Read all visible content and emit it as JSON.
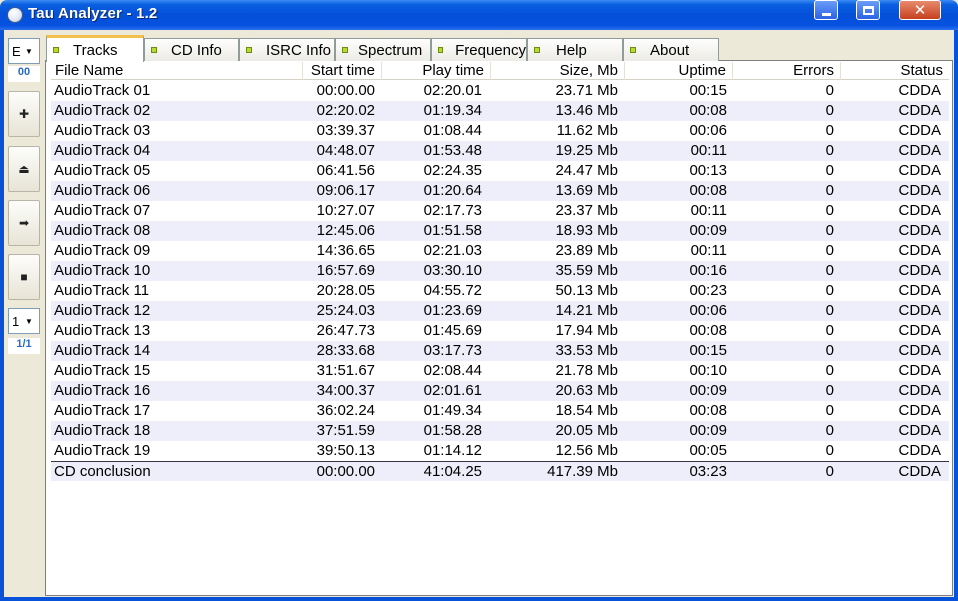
{
  "window": {
    "title": "Tau Analyzer - 1.2"
  },
  "sidebar": {
    "combo_top_value": "E",
    "track_value": "00",
    "combo_bottom_value": "1",
    "index_value": "1/1",
    "buttons": [
      {
        "name": "add-button",
        "glyph": "✚"
      },
      {
        "name": "eject-button",
        "glyph": "⏏"
      },
      {
        "name": "next-button",
        "glyph": "➡"
      },
      {
        "name": "stop-button",
        "glyph": "■"
      }
    ]
  },
  "tabs": [
    "Tracks",
    "CD Info",
    "ISRC Info",
    "Spectrum",
    "Frequency",
    "Help",
    "About"
  ],
  "table": {
    "columns": [
      "File Name",
      "Start time",
      "Play time",
      "Size, Mb",
      "Uptime",
      "Errors",
      "Status"
    ],
    "rows": [
      [
        "AudioTrack 01",
        "00:00.00",
        "02:20.01",
        "23.71 Mb",
        "00:15",
        "0",
        "CDDA"
      ],
      [
        "AudioTrack 02",
        "02:20.02",
        "01:19.34",
        "13.46 Mb",
        "00:08",
        "0",
        "CDDA"
      ],
      [
        "AudioTrack 03",
        "03:39.37",
        "01:08.44",
        "11.62 Mb",
        "00:06",
        "0",
        "CDDA"
      ],
      [
        "AudioTrack 04",
        "04:48.07",
        "01:53.48",
        "19.25 Mb",
        "00:11",
        "0",
        "CDDA"
      ],
      [
        "AudioTrack 05",
        "06:41.56",
        "02:24.35",
        "24.47 Mb",
        "00:13",
        "0",
        "CDDA"
      ],
      [
        "AudioTrack 06",
        "09:06.17",
        "01:20.64",
        "13.69 Mb",
        "00:08",
        "0",
        "CDDA"
      ],
      [
        "AudioTrack 07",
        "10:27.07",
        "02:17.73",
        "23.37 Mb",
        "00:11",
        "0",
        "CDDA"
      ],
      [
        "AudioTrack 08",
        "12:45.06",
        "01:51.58",
        "18.93 Mb",
        "00:09",
        "0",
        "CDDA"
      ],
      [
        "AudioTrack 09",
        "14:36.65",
        "02:21.03",
        "23.89 Mb",
        "00:11",
        "0",
        "CDDA"
      ],
      [
        "AudioTrack 10",
        "16:57.69",
        "03:30.10",
        "35.59 Mb",
        "00:16",
        "0",
        "CDDA"
      ],
      [
        "AudioTrack 11",
        "20:28.05",
        "04:55.72",
        "50.13 Mb",
        "00:23",
        "0",
        "CDDA"
      ],
      [
        "AudioTrack 12",
        "25:24.03",
        "01:23.69",
        "14.21 Mb",
        "00:06",
        "0",
        "CDDA"
      ],
      [
        "AudioTrack 13",
        "26:47.73",
        "01:45.69",
        "17.94 Mb",
        "00:08",
        "0",
        "CDDA"
      ],
      [
        "AudioTrack 14",
        "28:33.68",
        "03:17.73",
        "33.53 Mb",
        "00:15",
        "0",
        "CDDA"
      ],
      [
        "AudioTrack 15",
        "31:51.67",
        "02:08.44",
        "21.78 Mb",
        "00:10",
        "0",
        "CDDA"
      ],
      [
        "AudioTrack 16",
        "34:00.37",
        "02:01.61",
        "20.63 Mb",
        "00:09",
        "0",
        "CDDA"
      ],
      [
        "AudioTrack 17",
        "36:02.24",
        "01:49.34",
        "18.54 Mb",
        "00:08",
        "0",
        "CDDA"
      ],
      [
        "AudioTrack 18",
        "37:51.59",
        "01:58.28",
        "20.05 Mb",
        "00:09",
        "0",
        "CDDA"
      ],
      [
        "AudioTrack 19",
        "39:50.13",
        "01:14.12",
        "12.56 Mb",
        "00:05",
        "0",
        "CDDA"
      ]
    ],
    "total": [
      "CD conclusion",
      "00:00.00",
      "41:04.25",
      "417.39 Mb",
      "03:23",
      "0",
      "CDDA"
    ]
  },
  "colors": {
    "titlebar": "#0450d8",
    "alt_row": "#eeeefa",
    "tab_led": "#b8dc2a"
  }
}
